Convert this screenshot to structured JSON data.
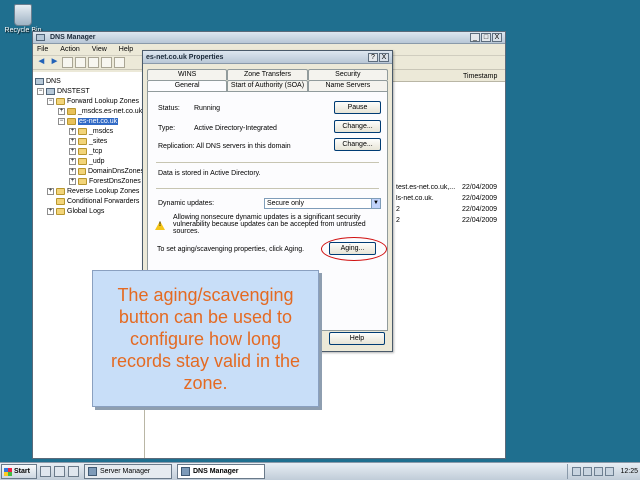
{
  "desktop": {
    "recycle_label": "Recycle Bin"
  },
  "window": {
    "title": "DNS Manager",
    "buttons": {
      "minimize": "_",
      "maximize": "□",
      "close": "X"
    }
  },
  "menu": [
    "File",
    "Action",
    "View",
    "Help"
  ],
  "tree": {
    "root": "DNS",
    "server": "DNSTEST",
    "forward": "Forward Lookup Zones",
    "zones": [
      "_msdcs.es-net.co.uk",
      "es-net.co.uk"
    ],
    "subfolders": [
      "_msdcs",
      "_sites",
      "_tcp",
      "_udp",
      "DomainDnsZones",
      "ForestDnsZones"
    ],
    "reverse": "Reverse Lookup Zones",
    "conditional": "Conditional Forwarders",
    "global_logs": "Global Logs"
  },
  "list": {
    "timestamp_header": "Timestamp",
    "rows": [
      {
        "data": "test.es-net.co.uk,...",
        "ts": "22/04/2009"
      },
      {
        "data": "ls-net.co.uk.",
        "ts": "22/04/2009"
      },
      {
        "data": "2",
        "ts": "22/04/2009"
      },
      {
        "data": "2",
        "ts": "22/04/2009"
      }
    ]
  },
  "dialog": {
    "title": "es-net.co.uk Properties",
    "help_btn": "?",
    "close_btn": "X",
    "tabs_row1": [
      "WINS",
      "Zone Transfers",
      "Security"
    ],
    "tabs_row2": [
      "General",
      "Start of Authority (SOA)",
      "Name Servers"
    ],
    "status_label": "Status:",
    "status_value": "Running",
    "pause_btn": "Pause",
    "type_label": "Type:",
    "type_value": "Active Directory-Integrated",
    "change_btn": "Change...",
    "replication_text": "Replication:  All DNS servers in this domain",
    "ad_text": "Data is stored in Active Directory.",
    "dynamic_label": "Dynamic updates:",
    "dynamic_value": "Secure only",
    "warning_text": "Allowing nonsecure dynamic updates is a significant security vulnerability because updates can be accepted from untrusted sources.",
    "aging_text": "To set aging/scavenging properties, click Aging.",
    "aging_btn": "Aging...",
    "help_button": "Help"
  },
  "callout": {
    "text": "The aging/scavenging button can be used to configure how long records stay valid in the zone."
  },
  "taskbar": {
    "start": "Start",
    "tasks": [
      "Server Manager",
      "DNS Manager"
    ],
    "clock": "12:25"
  },
  "colors": {
    "desktop": "#1f6f8f",
    "callout_text": "#e46a22",
    "callout_bg": "#c8def8",
    "highlight": "#d01010"
  }
}
